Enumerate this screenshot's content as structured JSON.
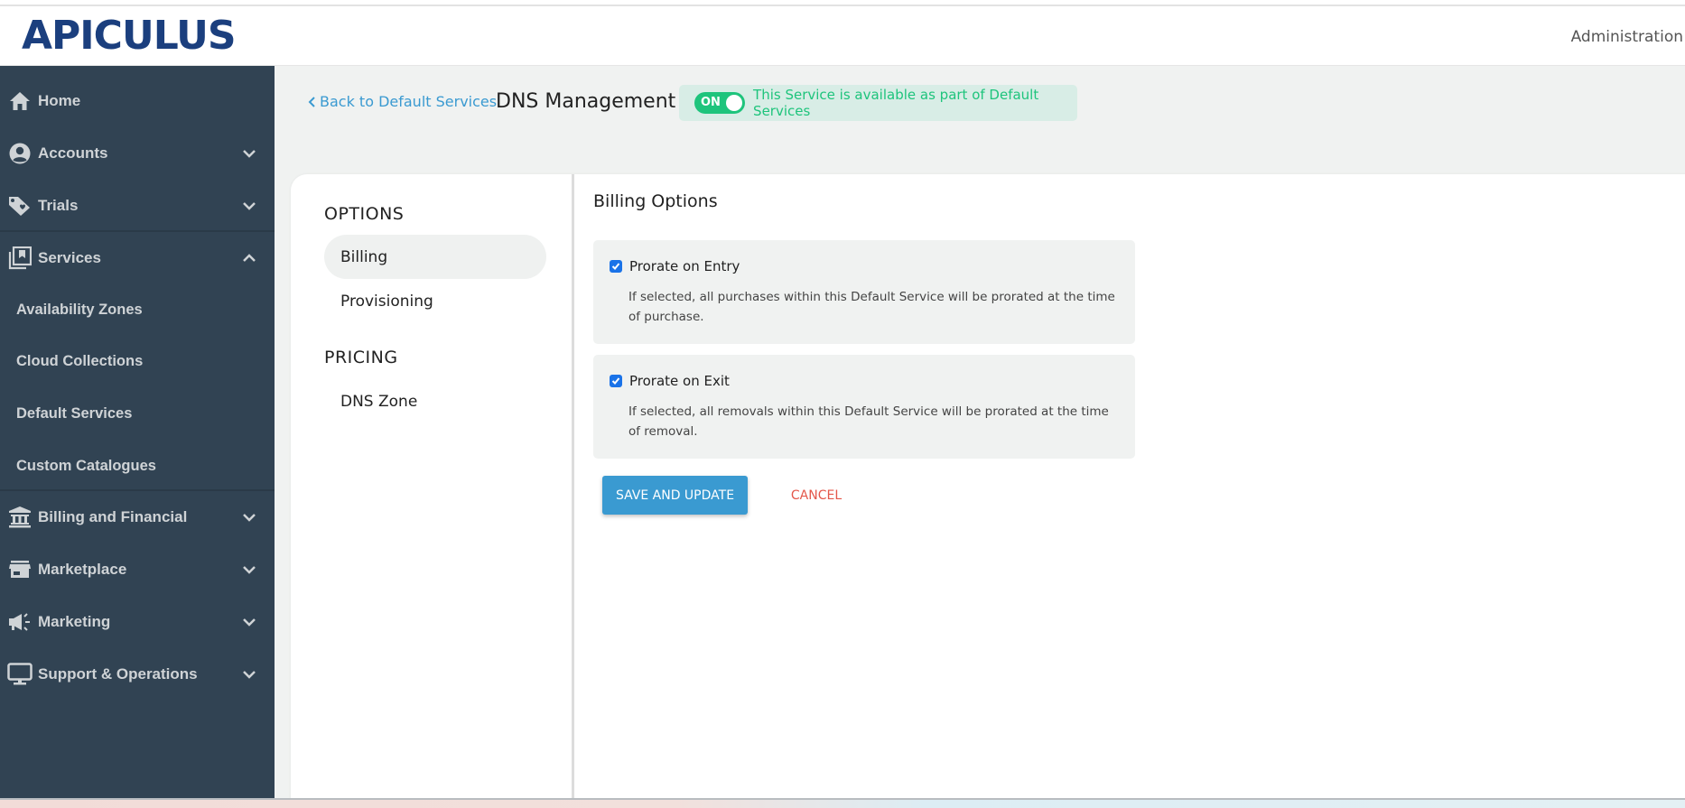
{
  "header": {
    "logo": "APICULUS",
    "right_label": "Administration"
  },
  "sidebar": {
    "items": [
      {
        "label": "Home",
        "icon": "home-icon",
        "chevron": "none"
      },
      {
        "label": "Accounts",
        "icon": "user-circle-icon",
        "chevron": "down"
      },
      {
        "label": "Trials",
        "icon": "tag-heart-icon",
        "chevron": "down"
      },
      {
        "label": "Services",
        "icon": "collections-icon",
        "chevron": "up",
        "expanded": true,
        "children": [
          {
            "label": "Availability Zones"
          },
          {
            "label": "Cloud Collections"
          },
          {
            "label": "Default Services"
          },
          {
            "label": "Custom Catalogues"
          }
        ]
      },
      {
        "label": "Billing and Financial",
        "icon": "bank-icon",
        "chevron": "down"
      },
      {
        "label": "Marketplace",
        "icon": "store-icon",
        "chevron": "down"
      },
      {
        "label": "Marketing",
        "icon": "megaphone-icon",
        "chevron": "down"
      },
      {
        "label": "Support & Operations",
        "icon": "monitor-icon",
        "chevron": "down"
      }
    ]
  },
  "page": {
    "back_link": "Back to Default Services",
    "title": "DNS Management",
    "toggle": {
      "label": "ON",
      "state": true
    },
    "status_text": "This Service is available as part of Default Services",
    "colors": {
      "accent": "#3a9ad1",
      "success": "#1ec47c",
      "danger": "#e4574a",
      "sidebar": "#314353"
    }
  },
  "options_panel": {
    "sections": [
      {
        "title": "OPTIONS",
        "items": [
          {
            "label": "Billing",
            "active": true
          },
          {
            "label": "Provisioning",
            "active": false
          }
        ]
      },
      {
        "title": "PRICING",
        "items": [
          {
            "label": "DNS Zone",
            "active": false
          }
        ]
      }
    ]
  },
  "billing": {
    "title": "Billing Options",
    "options": [
      {
        "label": "Prorate on Entry",
        "checked": true,
        "description": "If selected, all purchases within this Default Service will be prorated at the time of purchase."
      },
      {
        "label": "Prorate on Exit",
        "checked": true,
        "description": "If selected, all removals within this Default Service will be prorated at the time of removal."
      }
    ],
    "save_label": "SAVE AND UPDATE",
    "cancel_label": "CANCEL"
  }
}
